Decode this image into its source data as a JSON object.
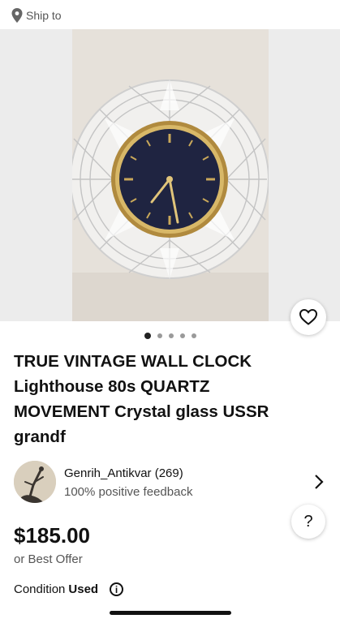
{
  "header": {
    "ship_label": "Ship to",
    "icon": "location-pin-icon"
  },
  "gallery": {
    "image_count": 5,
    "active_index": 0,
    "favorite_icon": "heart-icon"
  },
  "listing": {
    "title": "TRUE VINTAGE WALL CLOCK Lighthouse 80s QUARTZ MOVEMENT Crystal glass USSR grandf",
    "price": "$185.00",
    "offer_text": "or Best Offer",
    "condition_label": "Condition",
    "condition_value": "Used"
  },
  "seller": {
    "name": "Genrih_Antikvar (269)",
    "feedback": "100% positive feedback"
  },
  "help": {
    "label": "?"
  },
  "colors": {
    "accent": "#111111",
    "muted": "#555555",
    "dot_active": "#222222",
    "dot_inactive": "#9a9a9a"
  }
}
